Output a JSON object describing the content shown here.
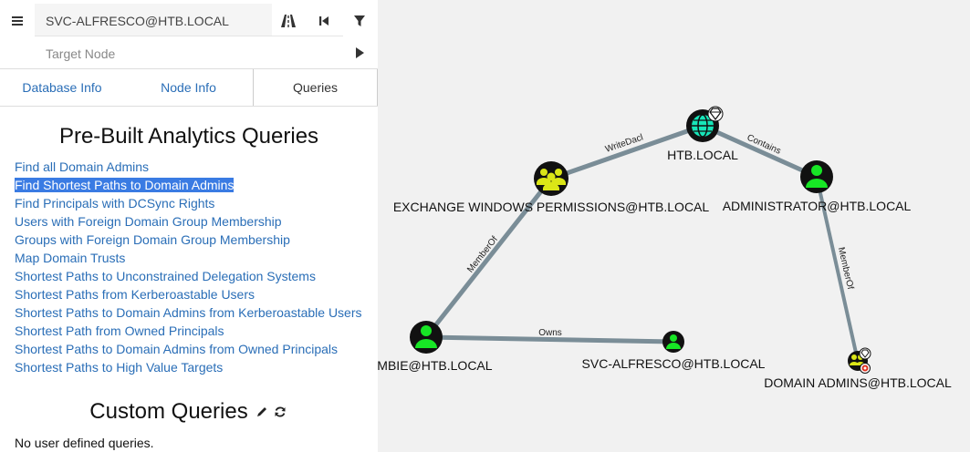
{
  "search": {
    "start_value": "SVC-ALFRESCO@HTB.LOCAL",
    "target_placeholder": "Target Node"
  },
  "tabs": [
    {
      "label": "Database Info"
    },
    {
      "label": "Node Info"
    },
    {
      "label": "Queries",
      "active": true
    }
  ],
  "prebuilt": {
    "title": "Pre-Built Analytics Queries",
    "queries": [
      "Find all Domain Admins",
      "Find Shortest Paths to Domain Admins",
      "Find Principals with DCSync Rights",
      "Users with Foreign Domain Group Membership",
      "Groups with Foreign Domain Group Membership",
      "Map Domain Trusts",
      "Shortest Paths to Unconstrained Delegation Systems",
      "Shortest Paths from Kerberoastable Users",
      "Shortest Paths to Domain Admins from Kerberoastable Users",
      "Shortest Path from Owned Principals",
      "Shortest Paths to Domain Admins from Owned Principals",
      "Shortest Paths to High Value Targets"
    ],
    "selected_index": 1
  },
  "custom": {
    "title": "Custom Queries",
    "empty_text": "No user defined queries."
  },
  "graph": {
    "nodes": {
      "htb_local": "HTB.LOCAL",
      "exchange": "EXCHANGE WINDOWS PERMISSIONS@HTB.LOCAL",
      "administrator": "ADMINISTRATOR@HTB.LOCAL",
      "zombie": "OMBIE@HTB.LOCAL",
      "svc_alfresco": "SVC-ALFRESCO@HTB.LOCAL",
      "domain_admins": "DOMAIN ADMINS@HTB.LOCAL"
    },
    "edges": {
      "writedacl": "WriteDacl",
      "contains": "Contains",
      "memberof_1": "MemberOf",
      "memberof_2": "MemberOf",
      "owns": "Owns"
    }
  },
  "colors": {
    "link": "#2a6eb7",
    "selection": "#3a7be3",
    "user_node": "#17e625",
    "group_node": "#dbe617",
    "domain_node": "#17e6b9",
    "edge": "#7a8d97"
  }
}
